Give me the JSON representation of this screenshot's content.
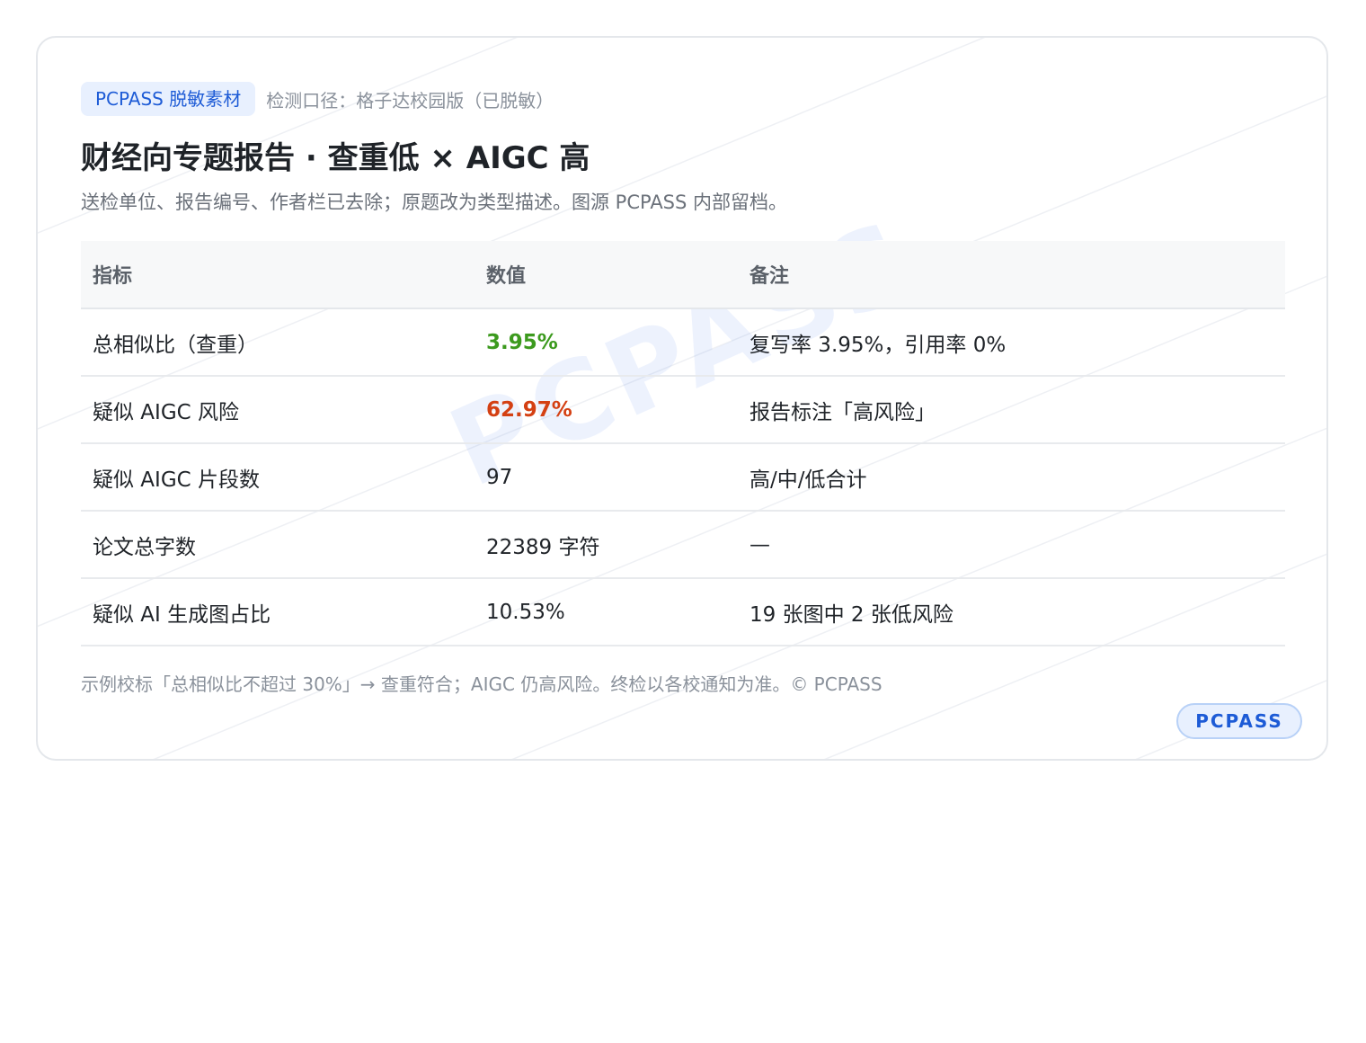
{
  "header": {
    "tag": "PCPASS 脱敏素材",
    "meta": "检测口径：格子达校园版（已脱敏）",
    "title": "财经向专题报告 · 查重低 × AIGC 高",
    "subtitle": "送检单位、报告编号、作者栏已去除；原题改为类型描述。图源 PCPASS 内部留档。"
  },
  "table": {
    "columns": [
      "指标",
      "数值",
      "备注"
    ],
    "rows": [
      {
        "metric": "总相似比（查重）",
        "value": "3.95%",
        "note": "复写率 3.95%，引用率 0%",
        "value_status": "good"
      },
      {
        "metric": "疑似 AIGC 风险",
        "value": "62.97%",
        "note": "报告标注「高风险」",
        "value_status": "bad"
      },
      {
        "metric": "疑似 AIGC 片段数",
        "value": "97",
        "note": "高/中/低合计",
        "value_status": "normal"
      },
      {
        "metric": "论文总字数",
        "value": "22389 字符",
        "note": "—",
        "value_status": "normal"
      },
      {
        "metric": "疑似 AI 生成图占比",
        "value": "10.53%",
        "note": "19 张图中 2 张低风险",
        "value_status": "normal"
      }
    ]
  },
  "footnote": "示例校标「总相似比不超过 30%」→ 查重符合；AIGC 仍高风险。终检以各校通知为准。© PCPASS",
  "badge": "PCPASS",
  "watermark": "PCPASS",
  "colors": {
    "accent": "#1d5bd6",
    "good": "#3c9a1e",
    "bad": "#d44013"
  }
}
